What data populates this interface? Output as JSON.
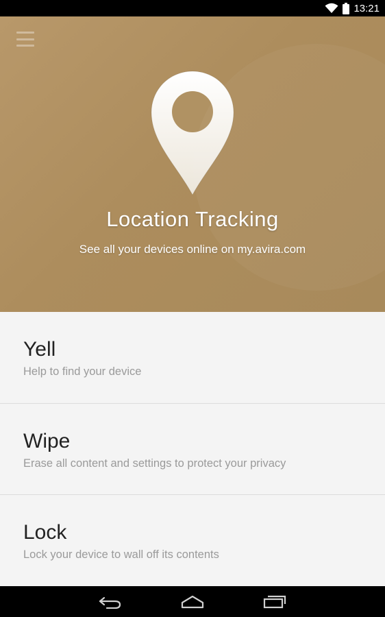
{
  "status_bar": {
    "time": "13:21",
    "icons": [
      "wifi-icon",
      "battery-icon"
    ]
  },
  "header": {
    "menu_icon": "menu-icon",
    "hero_icon": "location-pin-icon",
    "title": "Location Tracking",
    "subtitle": "See all your devices online on my.avira.com",
    "background_color": "#b09060"
  },
  "actions": [
    {
      "title": "Yell",
      "description": "Help to find your device"
    },
    {
      "title": "Wipe",
      "description": "Erase all content and settings to protect your privacy"
    },
    {
      "title": "Lock",
      "description": "Lock your device to wall off its contents"
    }
  ],
  "nav_bar": {
    "icons": [
      "back-icon",
      "home-icon",
      "recent-apps-icon"
    ]
  }
}
